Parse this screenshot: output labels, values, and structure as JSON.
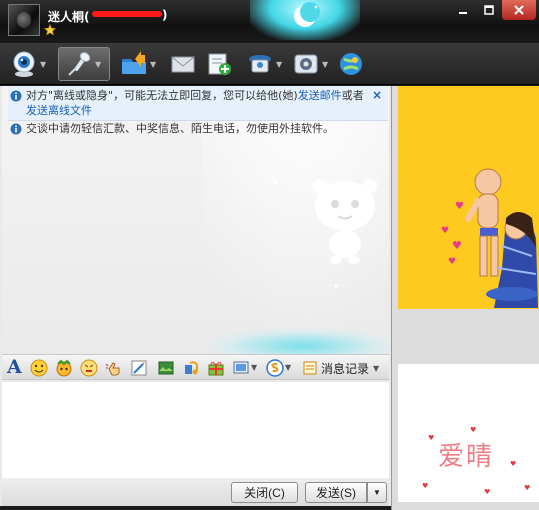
{
  "titlebar": {
    "nickname": "迷人桐(",
    "paren_close": ")",
    "minimize_icon": "minimize-icon",
    "maximize_icon": "maximize-icon",
    "close_icon": "close-icon"
  },
  "toolbar": {
    "tools": [
      "video-call",
      "voice-call",
      "file-transfer",
      "mail",
      "add-contact",
      "profile",
      "settings",
      "app"
    ],
    "active": "voice-call"
  },
  "notice": {
    "text_a": "对方\"离线或隐身\"，可能无法立即回复，您可以给他(她)",
    "link_a": "发送邮件",
    "text_b": "或者",
    "link_b": "发送离线文件",
    "close": "×"
  },
  "warning": {
    "text": "交谈中请勿轻信汇款、中奖信息、陌生电话，勿使用外挂软件。"
  },
  "format_bar": {
    "font_label": "A",
    "history_label": "消息记录"
  },
  "input": {
    "value": ""
  },
  "buttons": {
    "close": "关闭(C)",
    "send": "发送(S)"
  },
  "right_panel": {
    "image_text": "爱晴"
  },
  "colors": {
    "accent": "#1a5fb4",
    "show_background": "#ffca1f",
    "image_text": "#f07c84"
  }
}
